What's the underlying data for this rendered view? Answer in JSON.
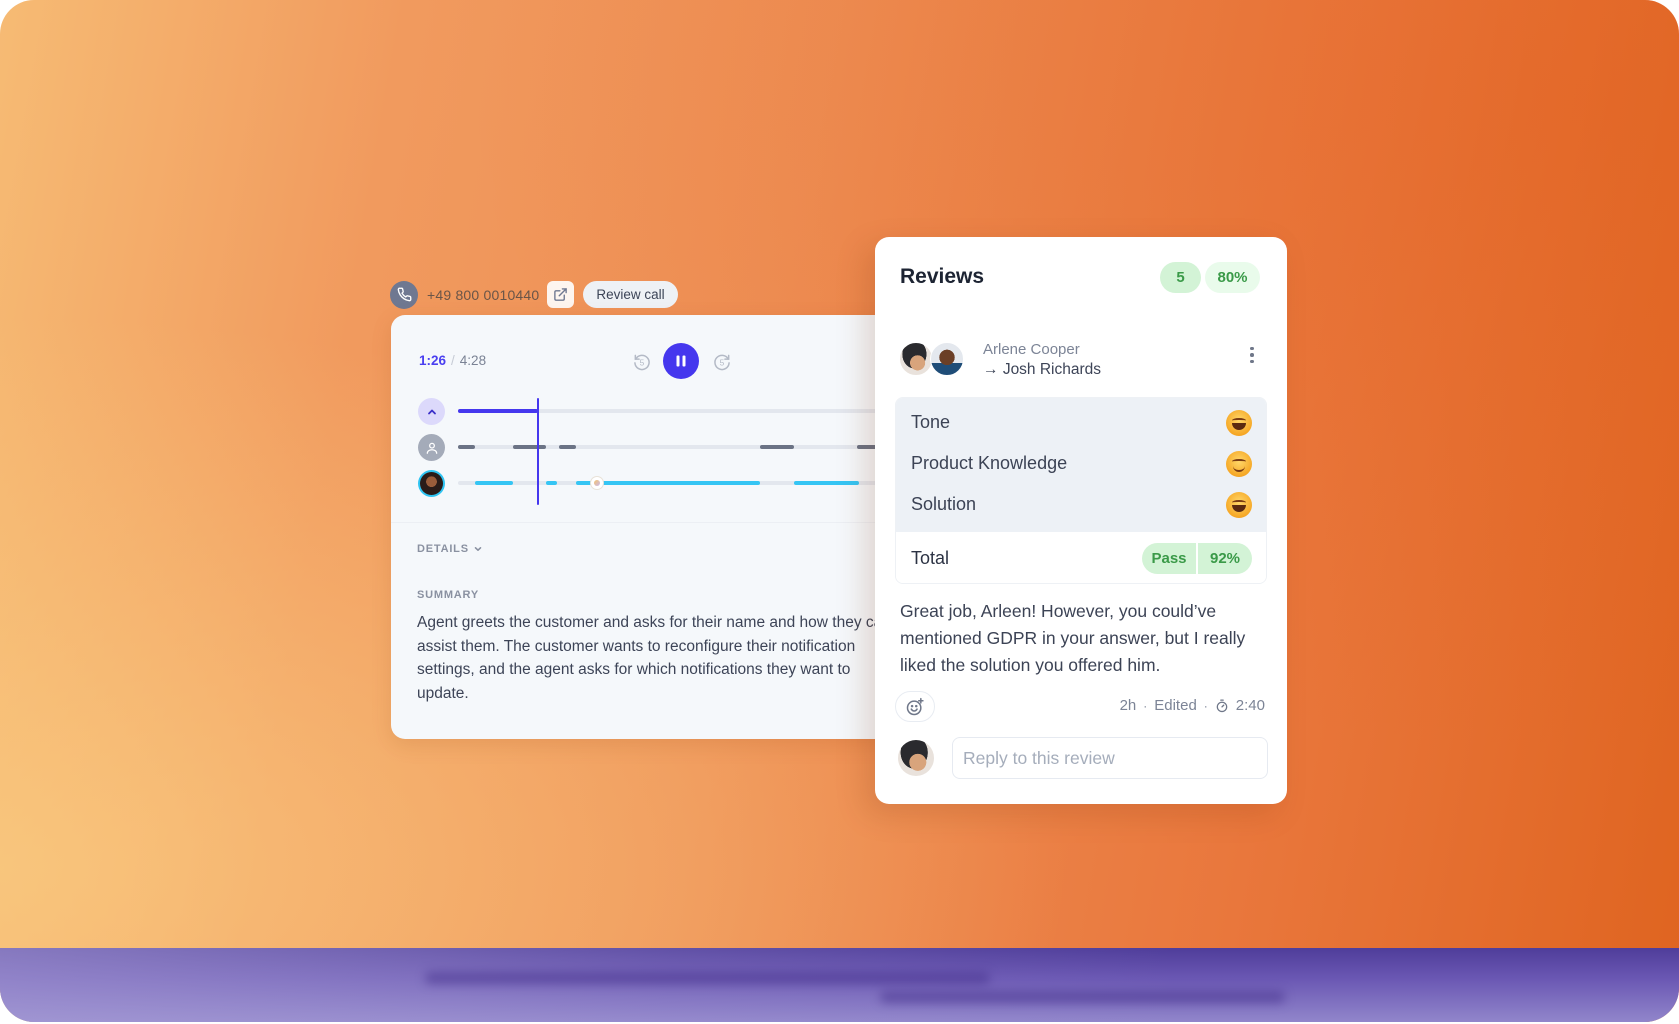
{
  "call_bar": {
    "phone_icon": "phone-icon",
    "phone_number": "+49 800 0010440",
    "open_external_icon": "external-link-icon",
    "review_call_label": "Review call"
  },
  "player": {
    "current_time": "1:26",
    "separator": "/",
    "duration": "4:28",
    "rewind_icon": "rewind-5s-icon",
    "pause_icon": "pause-icon",
    "forward_icon": "forward-5s-icon",
    "accent_color": "#4537ee",
    "timeline": {
      "playhead_fraction_of_visible_track": 0.19,
      "progress_track": {
        "icon": "chevron-up-icon",
        "segments": [
          [
            0.0,
            0.19
          ]
        ]
      },
      "agent_track": {
        "icon": "user-icon",
        "color": "#6b7385",
        "segments": [
          [
            0.0,
            0.04
          ],
          [
            0.13,
            0.21
          ],
          [
            0.24,
            0.28
          ],
          [
            0.72,
            0.8
          ],
          [
            0.95,
            1.0
          ]
        ]
      },
      "customer_track": {
        "icon": "customer-avatar",
        "color": "#35c5f4",
        "segments": [
          [
            0.04,
            0.13
          ],
          [
            0.21,
            0.235
          ],
          [
            0.28,
            0.72
          ],
          [
            0.8,
            0.955
          ]
        ],
        "marker_fraction": 0.33
      }
    }
  },
  "details": {
    "toggle_label": "DETAILS",
    "summary_label": "SUMMARY",
    "summary_lines": [
      "Agent greets the customer and asks for their name and how they can",
      "assist them. The customer wants to reconfigure their notification",
      "settings, and the agent asks for which notifications they want to",
      "update."
    ]
  },
  "reviews": {
    "title": "Reviews",
    "count_badge": "5",
    "percent_badge": "80%",
    "reviewer": "Arlene Cooper",
    "reviewee_arrow": "→",
    "reviewee": "Josh Richards",
    "criteria": [
      {
        "label": "Tone",
        "rating_icon": "grinning-emoji"
      },
      {
        "label": "Product Knowledge",
        "rating_icon": "smiling-emoji"
      },
      {
        "label": "Solution",
        "rating_icon": "grinning-emoji"
      }
    ],
    "total_label": "Total",
    "total_status": "Pass",
    "total_score": "92%",
    "comment": "Great job, Arleen! However, you could’ve mentioned GDPR in your answer, but I really liked the solution you offered him.",
    "meta": {
      "age": "2h",
      "edited": "Edited",
      "duration": "2:40",
      "dot": "·"
    },
    "reply_placeholder": "Reply to this review",
    "badge_green": "#3a9a48"
  }
}
